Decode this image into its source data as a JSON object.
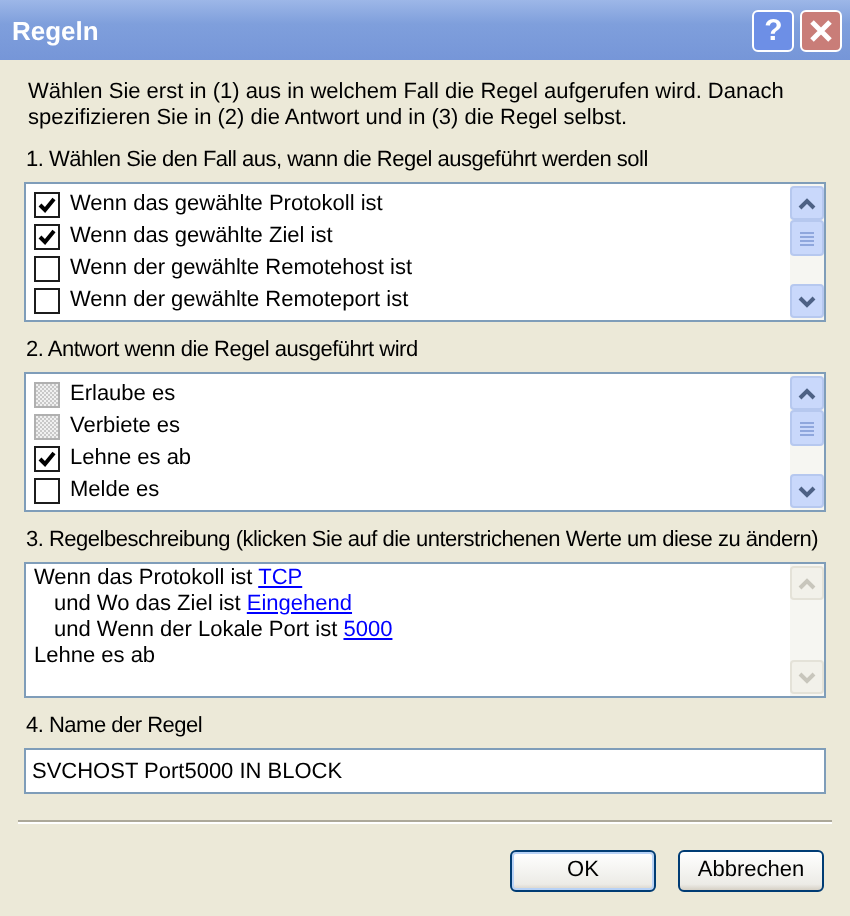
{
  "window": {
    "title": "Regeln",
    "help_button": "?"
  },
  "intro": "Wählen Sie erst in (1) aus in welchem Fall die Regel aufgerufen wird. Danach spezifizieren Sie in (2) die Antwort und in (3) die Regel selbst.",
  "conditions": {
    "label": "1. Wählen Sie den Fall aus, wann die Regel ausgeführt werden soll",
    "items": [
      {
        "text": "Wenn das gewählte Protokoll ist",
        "checked": true,
        "disabled": false
      },
      {
        "text": "Wenn das gewählte Ziel ist",
        "checked": true,
        "disabled": false
      },
      {
        "text": "Wenn der gewählte Remotehost ist",
        "checked": false,
        "disabled": false
      },
      {
        "text": "Wenn der gewählte Remoteport ist",
        "checked": false,
        "disabled": false
      }
    ]
  },
  "responses": {
    "label": "2. Antwort wenn die Regel ausgeführt wird",
    "items": [
      {
        "text": "Erlaube es",
        "checked": false,
        "disabled": true
      },
      {
        "text": "Verbiete es",
        "checked": false,
        "disabled": true
      },
      {
        "text": "Lehne es ab",
        "checked": true,
        "disabled": false
      },
      {
        "text": "Melde es",
        "checked": false,
        "disabled": false
      }
    ]
  },
  "description": {
    "label": "3. Regelbeschreibung (klicken Sie auf die unterstrichenen Werte um diese zu ändern)",
    "lines": [
      {
        "text": "Wenn das Protokoll ist",
        "link": "TCP",
        "children": [
          {
            "text": "und Wo das Ziel ist",
            "link": "Eingehend"
          },
          {
            "text": "und Wenn der Lokale Port ist",
            "link": "5000"
          }
        ]
      },
      {
        "text": "Lehne es ab"
      }
    ]
  },
  "rule_name": {
    "label": "4. Name der Regel",
    "value": "SVCHOST Port5000 IN BLOCK"
  },
  "buttons": [
    {
      "label": "OK",
      "default": true
    },
    {
      "label": "Abbrechen",
      "default": false
    }
  ]
}
